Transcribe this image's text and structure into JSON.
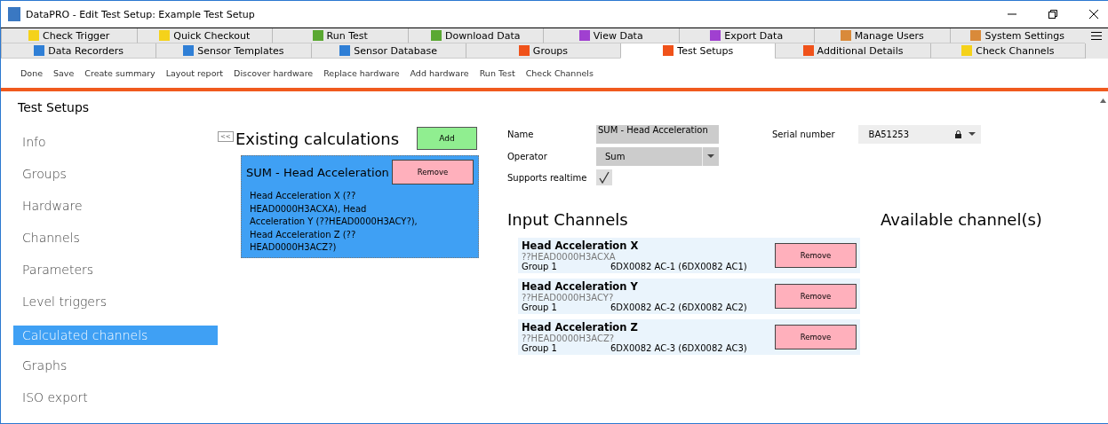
{
  "window": {
    "title": "DataPRO - Edit Test Setup: Example Test Setup"
  },
  "tab_rows": [
    [
      {
        "label": "Check Trigger",
        "color": "#f5d21a",
        "selected": false
      },
      {
        "label": "Quick Checkout",
        "color": "#f5d21a",
        "selected": false
      },
      {
        "label": "Run Test",
        "color": "#5aa832",
        "selected": false
      },
      {
        "label": "Download Data",
        "color": "#5aa832",
        "selected": false
      },
      {
        "label": "View Data",
        "color": "#a040d0",
        "selected": false
      },
      {
        "label": "Export Data",
        "color": "#a040d0",
        "selected": false
      },
      {
        "label": "Manage Users",
        "color": "#d98a3a",
        "selected": false
      },
      {
        "label": "System Settings",
        "color": "#d98a3a",
        "selected": false
      }
    ],
    [
      {
        "label": "Data Recorders",
        "color": "#2f7fd6",
        "selected": false
      },
      {
        "label": "Sensor Templates",
        "color": "#2f7fd6",
        "selected": false
      },
      {
        "label": "Sensor Database",
        "color": "#2f7fd6",
        "selected": false
      },
      {
        "label": "Groups",
        "color": "#f0521a",
        "selected": false
      },
      {
        "label": "Test Setups",
        "color": "#f0521a",
        "selected": true
      },
      {
        "label": "Additional Details",
        "color": "#f0521a",
        "selected": false
      },
      {
        "label": "Check Channels",
        "color": "#f5d21a",
        "selected": false
      }
    ]
  ],
  "toolbar": [
    "Done",
    "Save",
    "Create summary",
    "Layout report",
    "Discover hardware",
    "Replace hardware",
    "Add hardware",
    "Run Test",
    "Check Channels"
  ],
  "sidebar": {
    "title": "Test Setups",
    "collapse": "<<",
    "items": [
      {
        "label": "Info",
        "selected": false
      },
      {
        "label": "Groups",
        "selected": false
      },
      {
        "label": "Hardware",
        "selected": false
      },
      {
        "label": "Channels",
        "selected": false
      },
      {
        "label": "Parameters",
        "selected": false
      },
      {
        "label": "Level triggers",
        "selected": false
      },
      {
        "label": "Calculated channels",
        "selected": true
      },
      {
        "label": "Graphs",
        "selected": false
      },
      {
        "label": "ISO export",
        "selected": false
      }
    ]
  },
  "calculations": {
    "title": "Existing calculations",
    "add_button": "Add",
    "items": [
      {
        "name": "SUM - Head Acceleration",
        "remove_button": "Remove",
        "description": "Head Acceleration X (??HEAD0000H3ACXA), Head Acceleration Y (??HEAD0000H3ACY?), Head Acceleration Z (??HEAD0000H3ACZ?)",
        "selected": true
      }
    ]
  },
  "form": {
    "name_label": "Name",
    "name_value": "SUM - Head Acceleration",
    "operator_label": "Operator",
    "operator_value": "Sum",
    "realtime_label": "Supports realtime",
    "realtime_checked": true,
    "serial_label": "Serial number",
    "serial_value": "BA51253"
  },
  "input_channels": {
    "title": "Input Channels",
    "items": [
      {
        "name": "Head Acceleration X",
        "code": "??HEAD0000H3ACXA",
        "group": "Group 1",
        "hardware": "6DX0082 AC-1 (6DX0082 AC1)",
        "remove_button": "Remove"
      },
      {
        "name": "Head Acceleration Y",
        "code": "??HEAD0000H3ACY?",
        "group": "Group 1",
        "hardware": "6DX0082 AC-2 (6DX0082 AC2)",
        "remove_button": "Remove"
      },
      {
        "name": "Head Acceleration Z",
        "code": "??HEAD0000H3ACZ?",
        "group": "Group 1",
        "hardware": "6DX0082 AC-3 (6DX0082 AC3)",
        "remove_button": "Remove"
      }
    ]
  },
  "available_channels": {
    "title": "Available channel(s)"
  }
}
